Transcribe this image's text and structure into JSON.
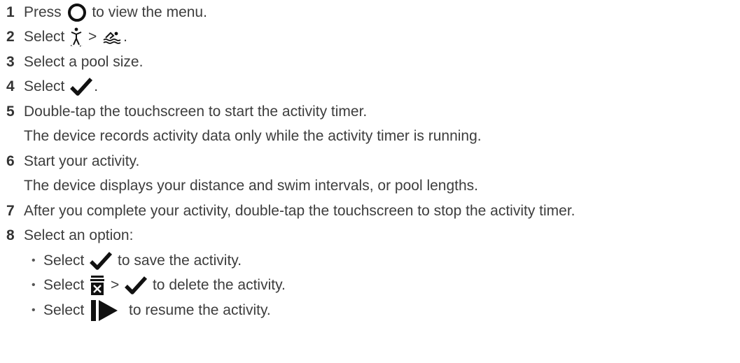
{
  "steps": [
    {
      "number": "1",
      "parts": [
        {
          "t": "Press "
        },
        {
          "icon": "circle-button-icon"
        },
        {
          "t": " to view the menu."
        }
      ]
    },
    {
      "number": "2",
      "parts": [
        {
          "t": "Select "
        },
        {
          "icon": "activity-person-icon"
        },
        {
          "t": " > "
        },
        {
          "icon": "pool-swim-icon"
        },
        {
          "t": "."
        }
      ]
    },
    {
      "number": "3",
      "parts": [
        {
          "t": "Select a pool size."
        }
      ]
    },
    {
      "number": "4",
      "parts": [
        {
          "t": "Select "
        },
        {
          "icon": "checkmark-icon"
        },
        {
          "t": "."
        }
      ]
    },
    {
      "number": "5",
      "parts": [
        {
          "t": "Double-tap the touchscreen to start the activity timer."
        }
      ]
    },
    {
      "number": "",
      "parts": [
        {
          "t": "The device records activity data only while the activity timer is running."
        }
      ]
    },
    {
      "number": "6",
      "parts": [
        {
          "t": "Start your activity."
        }
      ]
    },
    {
      "number": "",
      "parts": [
        {
          "t": "The device displays your distance and swim intervals, or pool lengths."
        }
      ]
    },
    {
      "number": "7",
      "parts": [
        {
          "t": "After you complete your activity, double-tap the touchscreen to stop the activity timer."
        }
      ]
    },
    {
      "number": "8",
      "parts": [
        {
          "t": "Select an option:"
        }
      ]
    }
  ],
  "options": [
    {
      "bullet": "•",
      "parts": [
        {
          "t": "Select "
        },
        {
          "icon": "checkmark-icon"
        },
        {
          "t": " to save the activity."
        }
      ]
    },
    {
      "bullet": "•",
      "parts": [
        {
          "t": "Select "
        },
        {
          "icon": "trash-discard-icon"
        },
        {
          "t": " > "
        },
        {
          "icon": "checkmark-icon"
        },
        {
          "t": " to delete the activity."
        }
      ]
    },
    {
      "bullet": "•",
      "parts": [
        {
          "t": "Select "
        },
        {
          "icon": "resume-play-icon"
        },
        {
          "t": " to resume the activity."
        }
      ]
    }
  ]
}
